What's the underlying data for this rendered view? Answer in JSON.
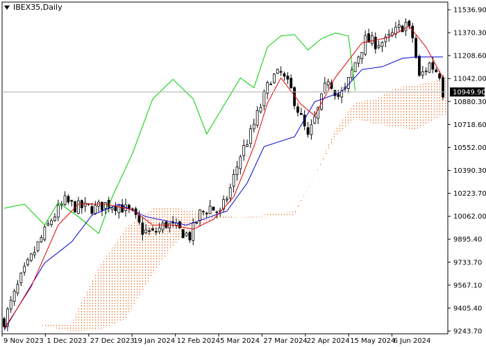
{
  "header": {
    "symbol": "IBEX35",
    "timeframe": "Daily",
    "title": "IBEX35,Daily"
  },
  "colors": {
    "background": "#ffffff",
    "axis": "#000000",
    "tenkan": "#e00000",
    "kijun": "#0000cc",
    "chikou": "#00cc00",
    "cloud": "#f08040",
    "candle": "#000000",
    "price_line": "#b0b0b0",
    "price_label_bg": "#000000",
    "price_label_text": "#ffffff"
  },
  "current_price": {
    "value": 10949.9,
    "label": "10949.90"
  },
  "chart_data": {
    "type": "candlestick",
    "title": "IBEX35,Daily",
    "indicator": "Ichimoku Kinko Hyo",
    "y_axis": {
      "ticks": [
        "11536.90",
        "11370.30",
        "11208.60",
        "11042.00",
        "10880.30",
        "10718.60",
        "10552.00",
        "10390.30",
        "10223.70",
        "10062.00",
        "9895.40",
        "9733.70",
        "9567.10",
        "9405.40",
        "9243.70"
      ],
      "ylim": [
        9243.7,
        11536.9
      ],
      "position": "right"
    },
    "x_axis": {
      "ticks": [
        "9 Nov 2023",
        "1 Dec 2023",
        "27 Dec 2023",
        "19 Jan 2024",
        "12 Feb 2024",
        "5 Mar 2024",
        "27 Mar 2024",
        "22 Apr 2024",
        "15 May 2024",
        "6 Jun 2024"
      ]
    },
    "trend_anchors": [
      {
        "bar": 0,
        "close": 9320
      },
      {
        "bar": 5,
        "close": 9620
      },
      {
        "bar": 10,
        "close": 9860
      },
      {
        "bar": 14,
        "close": 10040
      },
      {
        "bar": 18,
        "close": 10170
      },
      {
        "bar": 21,
        "close": 10130
      },
      {
        "bar": 27,
        "close": 10120
      },
      {
        "bar": 30,
        "close": 10150
      },
      {
        "bar": 34,
        "close": 10140
      },
      {
        "bar": 38,
        "close": 10080
      },
      {
        "bar": 41,
        "close": 9960
      },
      {
        "bar": 44,
        "close": 9940
      },
      {
        "bar": 48,
        "close": 10010
      },
      {
        "bar": 52,
        "close": 9960
      },
      {
        "bar": 55,
        "close": 9920
      },
      {
        "bar": 58,
        "close": 10080
      },
      {
        "bar": 61,
        "close": 10130
      },
      {
        "bar": 64,
        "close": 10080
      },
      {
        "bar": 67,
        "close": 10260
      },
      {
        "bar": 70,
        "close": 10500
      },
      {
        "bar": 73,
        "close": 10650
      },
      {
        "bar": 76,
        "close": 10850
      },
      {
        "bar": 79,
        "close": 11050
      },
      {
        "bar": 82,
        "close": 11080
      },
      {
        "bar": 85,
        "close": 10960
      },
      {
        "bar": 88,
        "close": 10760
      },
      {
        "bar": 90,
        "close": 10620
      },
      {
        "bar": 93,
        "close": 10820
      },
      {
        "bar": 96,
        "close": 11050
      },
      {
        "bar": 99,
        "close": 10920
      },
      {
        "bar": 101,
        "close": 10960
      },
      {
        "bar": 104,
        "close": 11160
      },
      {
        "bar": 107,
        "close": 11320
      },
      {
        "bar": 110,
        "close": 11300
      },
      {
        "bar": 113,
        "close": 11310
      },
      {
        "bar": 116,
        "close": 11380
      },
      {
        "bar": 119,
        "close": 11440
      },
      {
        "bar": 121,
        "close": 11340
      },
      {
        "bar": 123,
        "close": 11050
      },
      {
        "bar": 126,
        "close": 11150
      },
      {
        "bar": 129,
        "close": 11080
      },
      {
        "bar": 130,
        "close": 10950
      }
    ],
    "tenkan_sen": [
      [
        0,
        9260
      ],
      [
        8,
        9560
      ],
      [
        16,
        10000
      ],
      [
        22,
        10150
      ],
      [
        30,
        10150
      ],
      [
        38,
        10110
      ],
      [
        44,
        10000
      ],
      [
        50,
        10000
      ],
      [
        56,
        9970
      ],
      [
        62,
        10040
      ],
      [
        68,
        10200
      ],
      [
        74,
        10560
      ],
      [
        78,
        10870
      ],
      [
        82,
        11050
      ],
      [
        88,
        10860
      ],
      [
        92,
        10780
      ],
      [
        98,
        11050
      ],
      [
        106,
        11300
      ],
      [
        114,
        11340
      ],
      [
        120,
        11420
      ],
      [
        125,
        11270
      ],
      [
        130,
        11050
      ]
    ],
    "kijun_sen": [
      [
        0,
        9250
      ],
      [
        12,
        9730
      ],
      [
        20,
        9880
      ],
      [
        26,
        10070
      ],
      [
        34,
        10150
      ],
      [
        42,
        10060
      ],
      [
        54,
        10000
      ],
      [
        60,
        10050
      ],
      [
        66,
        10100
      ],
      [
        72,
        10300
      ],
      [
        77,
        10560
      ],
      [
        86,
        10630
      ],
      [
        92,
        10880
      ],
      [
        100,
        10950
      ],
      [
        106,
        11110
      ],
      [
        112,
        11130
      ],
      [
        118,
        11190
      ],
      [
        122,
        11200
      ],
      [
        130,
        11200
      ]
    ],
    "chikou_span": [
      [
        0,
        10120
      ],
      [
        6,
        10150
      ],
      [
        12,
        10000
      ],
      [
        16,
        10160
      ],
      [
        22,
        10060
      ],
      [
        28,
        9940
      ],
      [
        32,
        10200
      ],
      [
        38,
        10510
      ],
      [
        44,
        10900
      ],
      [
        50,
        11040
      ],
      [
        56,
        10900
      ],
      [
        60,
        10650
      ],
      [
        64,
        10810
      ],
      [
        70,
        11050
      ],
      [
        74,
        10980
      ],
      [
        78,
        11270
      ],
      [
        82,
        11350
      ],
      [
        86,
        11360
      ],
      [
        90,
        11250
      ],
      [
        94,
        11330
      ],
      [
        98,
        11370
      ],
      [
        102,
        11350
      ],
      [
        104,
        10960
      ]
    ],
    "senkou_span_a": [
      [
        0,
        9300
      ],
      [
        10,
        9290
      ],
      [
        20,
        9300
      ],
      [
        28,
        9700
      ],
      [
        36,
        9980
      ],
      [
        44,
        10120
      ],
      [
        50,
        10130
      ],
      [
        56,
        10100
      ],
      [
        62,
        10080
      ],
      [
        70,
        10050
      ],
      [
        78,
        10060
      ],
      [
        86,
        10070
      ],
      [
        92,
        10350
      ],
      [
        98,
        10680
      ],
      [
        104,
        10880
      ],
      [
        110,
        10900
      ],
      [
        116,
        10980
      ],
      [
        122,
        11000
      ],
      [
        128,
        11030
      ],
      [
        132,
        11080
      ]
    ],
    "senkou_span_b": [
      [
        0,
        9300
      ],
      [
        10,
        9290
      ],
      [
        20,
        9240
      ],
      [
        28,
        9250
      ],
      [
        36,
        9330
      ],
      [
        44,
        9650
      ],
      [
        50,
        9850
      ],
      [
        56,
        9980
      ],
      [
        62,
        10040
      ],
      [
        70,
        10050
      ],
      [
        78,
        10080
      ],
      [
        86,
        10100
      ],
      [
        92,
        10350
      ],
      [
        98,
        10620
      ],
      [
        104,
        10760
      ],
      [
        110,
        10720
      ],
      [
        116,
        10700
      ],
      [
        122,
        10680
      ],
      [
        128,
        10760
      ],
      [
        132,
        10800
      ]
    ]
  }
}
